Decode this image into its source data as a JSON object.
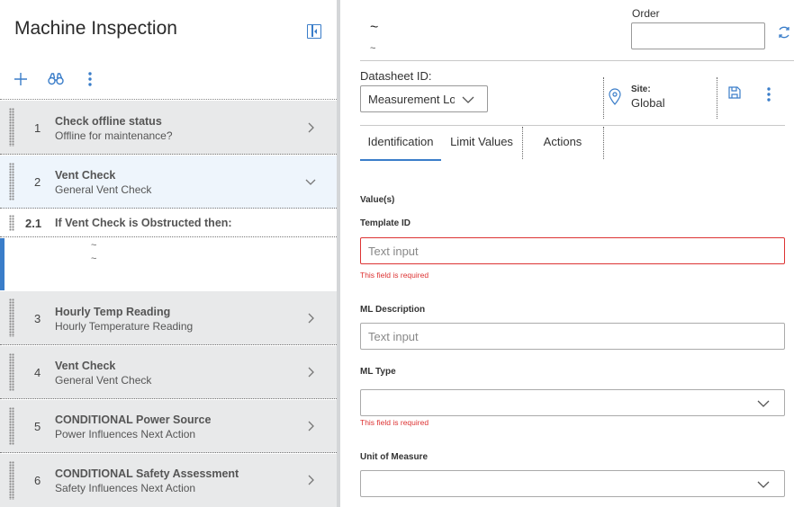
{
  "left": {
    "title": "Machine Inspection",
    "rows": [
      {
        "num": "1",
        "title": "Check offline status",
        "sub": "Offline for maintenance?"
      },
      {
        "num": "2",
        "title": "Vent Check",
        "sub": "General Vent Check"
      },
      {
        "num": "2.1",
        "title": "If Vent Check is Obstructed then:",
        "sub": ""
      },
      {
        "num": "3",
        "title": "Hourly Temp Reading",
        "sub": "Hourly Temperature Reading"
      },
      {
        "num": "4",
        "title": "Vent Check",
        "sub": "General Vent Check"
      },
      {
        "num": "5",
        "title": "CONDITIONAL Power Source",
        "sub": "Power Influences Next Action"
      },
      {
        "num": "6",
        "title": "CONDITIONAL Safety Assessment",
        "sub": "Safety Influences Next Action"
      }
    ],
    "placeholder_line1": "~",
    "placeholder_line2": "~"
  },
  "header": {
    "title": "~",
    "subtitle": "~",
    "order_label": "Order",
    "order_value": ""
  },
  "datasheet": {
    "label": "Datasheet ID:",
    "value": "Measurement Lo",
    "site_label": "Site:",
    "site_value": "Global"
  },
  "tabs": [
    {
      "label": "Identification",
      "active": true
    },
    {
      "label": "Limit Values",
      "active": false
    },
    {
      "label": "Actions",
      "active": false
    }
  ],
  "form": {
    "section": "Value(s)",
    "template_id_label": "Template ID",
    "template_id_placeholder": "Text input",
    "template_id_error": "This field is required",
    "ml_description_label": "ML Description",
    "ml_description_placeholder": "Text input",
    "ml_type_label": "ML Type",
    "ml_type_value": "",
    "ml_type_error": "This field is required",
    "unit_label": "Unit of Measure",
    "unit_value": ""
  },
  "colors": {
    "accent": "#3a7dc9",
    "error": "#d33333",
    "row_bg": "#e8e9ea",
    "selected_bg": "#eef5fc"
  }
}
